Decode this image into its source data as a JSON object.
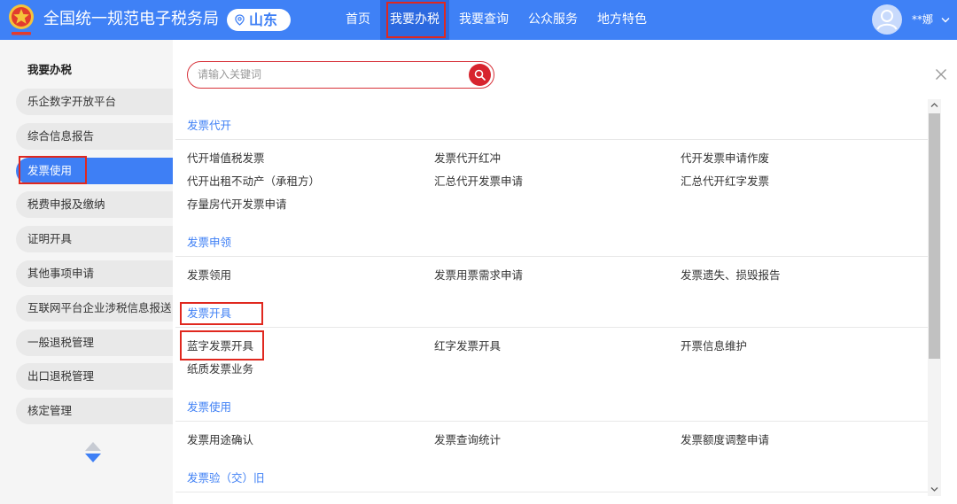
{
  "header": {
    "title": "全国统一规范电子税务局",
    "logo_icon": "tax-emblem-icon",
    "region": {
      "icon": "location-pin-icon",
      "name": "山东"
    },
    "nav": [
      {
        "label": "首页"
      },
      {
        "label": "我要办税",
        "active": true,
        "highlighted": true
      },
      {
        "label": "我要查询"
      },
      {
        "label": "公众服务"
      },
      {
        "label": "地方特色"
      }
    ],
    "user": {
      "avatar_icon": "user-avatar-icon",
      "name": "**娜",
      "menu_icon": "chevron-down-icon"
    }
  },
  "sidebar": {
    "title": "我要办税",
    "items": [
      {
        "label": "乐企数字开放平台"
      },
      {
        "label": "综合信息报告"
      },
      {
        "label": "发票使用",
        "active": true,
        "highlighted": true
      },
      {
        "label": "税费申报及缴纳"
      },
      {
        "label": "证明开具"
      },
      {
        "label": "其他事项申请"
      },
      {
        "label": "互联网平台企业涉税信息报送"
      },
      {
        "label": "一般退税管理"
      },
      {
        "label": "出口退税管理"
      },
      {
        "label": "核定管理"
      }
    ],
    "scroll_up_icon": "triangle-up-icon",
    "scroll_down_icon": "triangle-down-icon"
  },
  "panel": {
    "search": {
      "placeholder": "请输入关键词",
      "button_icon": "search-icon"
    },
    "close_icon": "close-icon",
    "sections": [
      {
        "title": "发票代开",
        "items": [
          {
            "label": "代开增值税发票"
          },
          {
            "label": "发票代开红冲"
          },
          {
            "label": "代开发票申请作废"
          },
          {
            "label": "代开出租不动产（承租方）"
          },
          {
            "label": "汇总代开发票申请"
          },
          {
            "label": "汇总代开红字发票"
          },
          {
            "label": "存量房代开发票申请"
          }
        ]
      },
      {
        "title": "发票申领",
        "items": [
          {
            "label": "发票领用"
          },
          {
            "label": "发票用票需求申请"
          },
          {
            "label": "发票遗失、损毁报告"
          }
        ]
      },
      {
        "title": "发票开具",
        "title_highlighted": true,
        "items": [
          {
            "label": "蓝字发票开具",
            "highlighted": true
          },
          {
            "label": "红字发票开具"
          },
          {
            "label": "开票信息维护"
          },
          {
            "label": "纸质发票业务"
          }
        ]
      },
      {
        "title": "发票使用",
        "items": [
          {
            "label": "发票用途确认"
          },
          {
            "label": "发票查询统计"
          },
          {
            "label": "发票额度调整申请"
          }
        ]
      },
      {
        "title": "发票验（交）旧",
        "items": []
      }
    ]
  },
  "colors": {
    "header_blue": "#3f81f6",
    "active_nav": "#2c69e0",
    "accent_blue": "#3e7ff5",
    "search_red": "#d7242e",
    "annotation_red": "#e0281f",
    "sidebar_bg": "#f5f5f5",
    "sidebar_item_bg": "#e9e9e9",
    "text": "#333333"
  }
}
